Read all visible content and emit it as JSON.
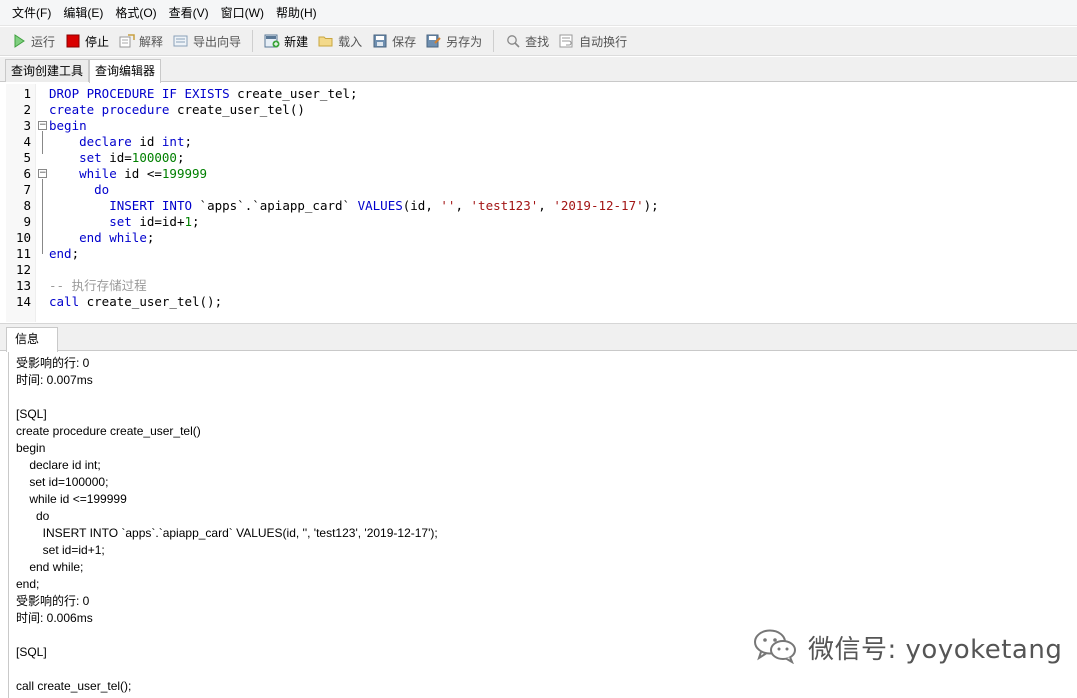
{
  "menu": [
    "文件(F)",
    "编辑(E)",
    "格式(O)",
    "查看(V)",
    "窗口(W)",
    "帮助(H)"
  ],
  "toolbar": {
    "run": "运行",
    "stop": "停止",
    "explain": "解释",
    "export_wizard": "导出向导",
    "new": "新建",
    "load": "载入",
    "save": "保存",
    "save_as": "另存为",
    "find": "查找",
    "word_wrap": "自动换行"
  },
  "tabs": [
    "查询创建工具",
    "查询编辑器"
  ],
  "active_tab": "查询编辑器",
  "editor": {
    "line_numbers": [
      "1",
      "2",
      "3",
      "4",
      "5",
      "6",
      "7",
      "8",
      "9",
      "10",
      "11",
      "12",
      "13",
      "14"
    ],
    "lines": [
      [
        {
          "t": "DROP PROCEDURE IF EXISTS",
          "c": "kw"
        },
        {
          "t": " create_user_tel;",
          "c": ""
        }
      ],
      [
        {
          "t": "create procedure",
          "c": "kw"
        },
        {
          "t": " create_user_tel()",
          "c": ""
        }
      ],
      [
        {
          "t": "begin",
          "c": "kw"
        }
      ],
      [
        {
          "t": "    ",
          "c": ""
        },
        {
          "t": "declare",
          "c": "kw"
        },
        {
          "t": " id ",
          "c": ""
        },
        {
          "t": "int",
          "c": "kw"
        },
        {
          "t": ";",
          "c": ""
        }
      ],
      [
        {
          "t": "    ",
          "c": ""
        },
        {
          "t": "set",
          "c": "kw"
        },
        {
          "t": " id=",
          "c": ""
        },
        {
          "t": "100000",
          "c": "num"
        },
        {
          "t": ";",
          "c": ""
        }
      ],
      [
        {
          "t": "    ",
          "c": ""
        },
        {
          "t": "while",
          "c": "kw"
        },
        {
          "t": " id <=",
          "c": ""
        },
        {
          "t": "199999",
          "c": "num"
        }
      ],
      [
        {
          "t": "      ",
          "c": ""
        },
        {
          "t": "do",
          "c": "kw"
        }
      ],
      [
        {
          "t": "        ",
          "c": ""
        },
        {
          "t": "INSERT INTO",
          "c": "kw"
        },
        {
          "t": " `apps`.`apiapp_card` ",
          "c": ""
        },
        {
          "t": "VALUES",
          "c": "kw"
        },
        {
          "t": "(id, ",
          "c": ""
        },
        {
          "t": "''",
          "c": "str"
        },
        {
          "t": ", ",
          "c": ""
        },
        {
          "t": "'test123'",
          "c": "str"
        },
        {
          "t": ", ",
          "c": ""
        },
        {
          "t": "'2019-12-17'",
          "c": "str"
        },
        {
          "t": ");",
          "c": ""
        }
      ],
      [
        {
          "t": "        ",
          "c": ""
        },
        {
          "t": "set",
          "c": "kw"
        },
        {
          "t": " id=id+",
          "c": ""
        },
        {
          "t": "1",
          "c": "num"
        },
        {
          "t": ";",
          "c": ""
        }
      ],
      [
        {
          "t": "    ",
          "c": ""
        },
        {
          "t": "end while",
          "c": "kw"
        },
        {
          "t": ";",
          "c": ""
        }
      ],
      [
        {
          "t": "end",
          "c": "kw"
        },
        {
          "t": ";",
          "c": ""
        }
      ],
      [],
      [
        {
          "t": "-- 执行存储过程",
          "c": "cmt"
        }
      ],
      [
        {
          "t": "call",
          "c": "kw"
        },
        {
          "t": " create_user_tel();",
          "c": ""
        }
      ]
    ]
  },
  "info": {
    "tab_label": "信息",
    "lines": [
      "受影响的行: 0",
      "时间: 0.007ms",
      "",
      "[SQL]",
      "create procedure create_user_tel()",
      "begin",
      "    declare id int;",
      "    set id=100000;",
      "    while id <=199999",
      "      do",
      "        INSERT INTO `apps`.`apiapp_card` VALUES(id, '', 'test123', '2019-12-17');",
      "        set id=id+1;",
      "    end while;",
      "end;",
      "受影响的行: 0",
      "时间: 0.006ms",
      "",
      "[SQL]",
      "",
      "call create_user_tel();"
    ]
  },
  "watermark": "微信号: yoyoketang",
  "colors": {
    "keyword": "#0000cc",
    "number": "#008000",
    "string": "#a31515",
    "comment": "#9a9a9a",
    "stop_red": "#d90000",
    "run_green": "#2eb82e"
  },
  "icons": {
    "run": "play-icon",
    "stop": "stop-icon",
    "explain": "explain-icon",
    "export_wizard": "export-icon",
    "new": "new-query-icon",
    "load": "folder-icon",
    "save": "save-icon",
    "save_as": "save-as-icon",
    "find": "search-icon",
    "word_wrap": "wrap-icon",
    "watermark": "wechat-icon"
  }
}
